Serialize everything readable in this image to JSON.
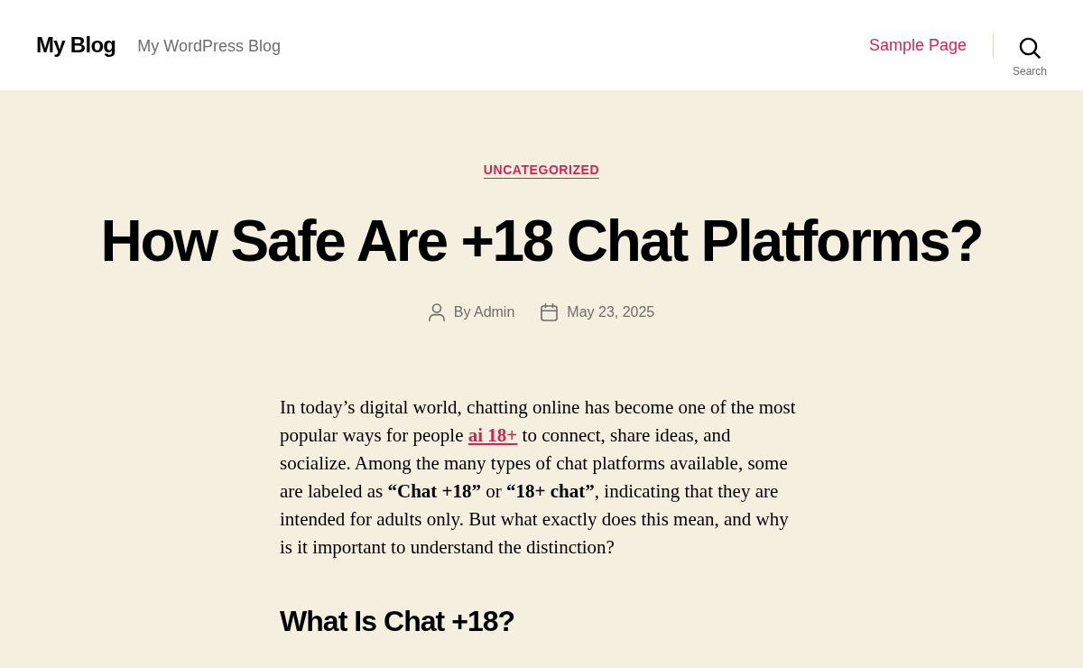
{
  "header": {
    "site_title": "My Blog",
    "site_description": "My WordPress Blog",
    "nav": [
      {
        "label": "Sample Page"
      }
    ],
    "search": {
      "label": "Search"
    }
  },
  "post": {
    "category": "UNCATEGORIZED",
    "title": "How Safe Are +18 Chat Platforms?",
    "meta": {
      "author": "By Admin",
      "date": "May 23, 2025"
    },
    "content": [
      {
        "kind": "paragraph",
        "segments": [
          {
            "kind": "text",
            "text": "In today’s digital world, chatting online has become one of the most popular ways for people"
          },
          {
            "kind": "link",
            "text": "ai 18+"
          },
          {
            "kind": "text",
            "text": "to connect, share ideas, and socialize. Among the many types of chat platforms available, some are labeled as **“Chat +18”** or **“18+ chat”**, indicating that they are intended for adults only. But what exactly does this mean, and why is it important to understand the distinction?"
          }
        ]
      },
      {
        "kind": "heading",
        "text": "What Is Chat +18?"
      }
    ]
  }
}
